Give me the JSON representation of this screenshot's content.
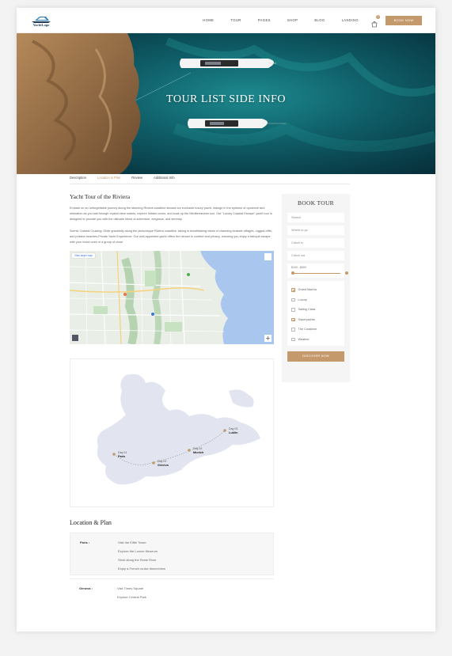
{
  "header": {
    "logo_text": "YachtLogo",
    "nav": [
      "HOME",
      "TOUR",
      "PAGES",
      "SHOP",
      "BLOG",
      "LANDING"
    ],
    "cart_count": "0",
    "book_button": "BOOK NOW"
  },
  "hero": {
    "title": "TOUR LIST SIDE INFO"
  },
  "tabs": [
    {
      "label": "Description",
      "active": false
    },
    {
      "label": "Location & Plan",
      "active": true
    },
    {
      "label": "Review",
      "active": false
    },
    {
      "label": "Additional Info",
      "active": false
    }
  ],
  "content": {
    "title": "Yacht Tour of the Riviera",
    "paragraphs": [
      "Embark on an unforgettable journey along the stunning Riviera coastline aboard our exclusive luxury yacht. Indulge in the epitome of opulence and relaxation as you sail through crystal-clear waters, explore hidden coves, and soak up the Mediterranean sun. Our \"Luxury Coastal Escape\" yacht tour is designed to provide you with the ultimate blend of adventure, elegance, and serenity.",
      "Scenic Coastal Cruising: Glide gracefully along the picturesque Riviera coastline, taking in breathtaking views of charming seaside villages, rugged cliffs, and pristine beaches.Private Yacht Experience: Our well-appointed yacht offers the utmost in comfort and privacy, ensuring you enjoy a tranquil escape with your loved ones or a group of close"
    ],
    "map_button": "View larger map"
  },
  "route": {
    "stops": [
      {
        "day": "Day 01",
        "city": "Paris"
      },
      {
        "day": "Day 02",
        "city": "Geneva"
      },
      {
        "day": "Day 02",
        "city": "Munich"
      },
      {
        "day": "Day 03",
        "city": "Lublin"
      }
    ]
  },
  "location": {
    "title": "Location & Plan",
    "entries": [
      {
        "city": "Paris :",
        "items": [
          "Visit the Eiffel Tower",
          "Explore the Louvre Museum",
          "Stroll along the Seine River",
          "Enjoy a French cruise dinner/view"
        ]
      },
      {
        "city": "Geneva :",
        "items": [
          "Visit Times Square",
          "Explore Central Park"
        ]
      }
    ]
  },
  "sidebar": {
    "title": "BOOK TOUR",
    "search_placeholder": "Search",
    "where_placeholder": "Where to go",
    "checkin_placeholder": "Check in",
    "checkout_placeholder": "Check out",
    "price_label": "$100 - $600",
    "price_range_fraction": [
      0.0,
      1.0
    ],
    "checks": [
      {
        "label": "Grand Marina",
        "checked": true
      },
      {
        "label": "Luxury",
        "checked": false
      },
      {
        "label": "Sailing Class",
        "checked": false
      },
      {
        "label": "Superyachts",
        "checked": true
      },
      {
        "label": "The Coralinne",
        "checked": false
      },
      {
        "label": "Weather",
        "checked": false
      }
    ],
    "button": "DISCOVER NOW"
  },
  "colors": {
    "accent": "#c49a6c",
    "sea": "#0e4b55",
    "water_map": "#a9c6ee"
  }
}
